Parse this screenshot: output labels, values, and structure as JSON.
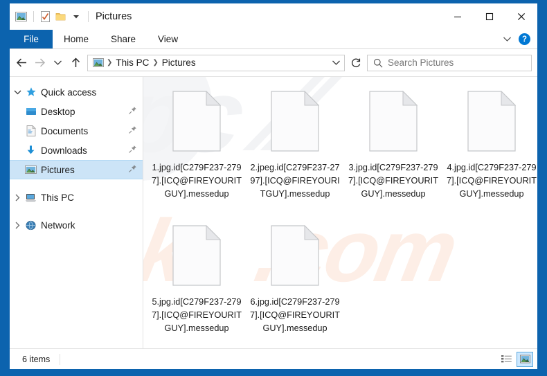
{
  "window": {
    "title": "Pictures",
    "quick_access_toolbar": [
      {
        "name": "pictures-library-icon",
        "label": "Pictures library"
      },
      {
        "name": "properties-icon",
        "label": "Properties"
      },
      {
        "name": "new-folder-icon",
        "label": "New folder"
      },
      {
        "name": "customize-quick-access-icon",
        "label": "Customize Quick Access Toolbar"
      }
    ],
    "controls": {
      "minimize": "—",
      "maximize": "□",
      "close": "✕"
    }
  },
  "ribbon": {
    "tabs": [
      {
        "label": "File",
        "active": true
      },
      {
        "label": "Home",
        "active": false
      },
      {
        "label": "Share",
        "active": false
      },
      {
        "label": "View",
        "active": false
      }
    ],
    "expand_label": "⌄",
    "help_label": "?"
  },
  "navigation": {
    "back_label": "Back",
    "forward_label": "Forward",
    "recent_label": "Recent locations",
    "up_label": "Up",
    "refresh_label": "Refresh",
    "address_dropdown_label": "Previous locations",
    "breadcrumb": [
      "This PC",
      "Pictures"
    ],
    "breadcrumb_separator": "❯"
  },
  "search": {
    "placeholder": "Search Pictures",
    "value": ""
  },
  "sidebar": {
    "items": [
      {
        "label": "Quick access",
        "icon": "star-icon",
        "chevron": "expanded",
        "indent": false,
        "pinned": false,
        "selected": false
      },
      {
        "label": "Desktop",
        "icon": "desktop-icon",
        "chevron": "none",
        "indent": true,
        "pinned": true,
        "selected": false
      },
      {
        "label": "Documents",
        "icon": "documents-icon",
        "chevron": "none",
        "indent": true,
        "pinned": true,
        "selected": false
      },
      {
        "label": "Downloads",
        "icon": "downloads-icon",
        "chevron": "none",
        "indent": true,
        "pinned": true,
        "selected": false
      },
      {
        "label": "Pictures",
        "icon": "pictures-icon",
        "chevron": "none",
        "indent": true,
        "pinned": true,
        "selected": true
      },
      {
        "label": "This PC",
        "icon": "this-pc-icon",
        "chevron": "collapsed",
        "indent": false,
        "pinned": false,
        "selected": false
      },
      {
        "label": "Network",
        "icon": "network-icon",
        "chevron": "collapsed",
        "indent": false,
        "pinned": false,
        "selected": false
      }
    ]
  },
  "files": [
    {
      "name": "1.jpg.id[C279F237-2797].[ICQ@FIREYOURITGUY].messedup",
      "icon": "generic-file-icon"
    },
    {
      "name": "2.jpeg.id[C279F237-2797].[ICQ@FIREYOURITGUY].messedup",
      "icon": "generic-file-icon"
    },
    {
      "name": "3.jpg.id[C279F237-2797].[ICQ@FIREYOURITGUY].messedup",
      "icon": "generic-file-icon"
    },
    {
      "name": "4.jpg.id[C279F237-2797].[ICQ@FIREYOURITGUY].messedup",
      "icon": "generic-file-icon"
    },
    {
      "name": "5.jpg.id[C279F237-2797].[ICQ@FIREYOURITGUY].messedup",
      "icon": "generic-file-icon"
    },
    {
      "name": "6.jpg.id[C279F237-2797].[ICQ@FIREYOURITGUY].messedup",
      "icon": "generic-file-icon"
    }
  ],
  "status": {
    "item_count": "6 items",
    "details_view_label": "Details view",
    "large_icons_view_label": "Large icons view",
    "active_view": "large-icons"
  },
  "watermark": {
    "gray_text": "pc",
    "pink_text_left": "risk",
    "pink_text_right": ".com"
  },
  "colors": {
    "frame_blue": "#0c63ae",
    "file_tab_blue": "#0c63ae",
    "selection_blue": "#cce4f7",
    "help_blue": "#0078d4",
    "watermark_pink": "#fdeee6",
    "watermark_gray": "#f2f3f5"
  }
}
